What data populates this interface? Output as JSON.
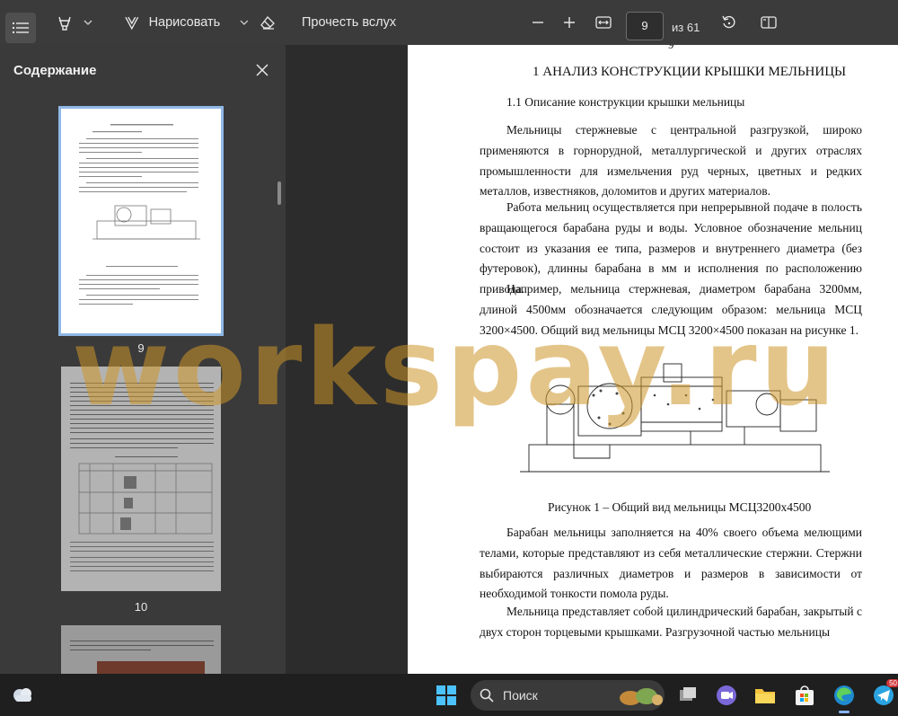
{
  "toolbar": {
    "draw_label": "Нарисовать",
    "read_aloud_label": "Прочесть вслух",
    "page_input_value": "9",
    "page_total_label": "из 61"
  },
  "sidebar": {
    "title": "Содержание",
    "thumbnails": [
      {
        "label": "9"
      },
      {
        "label": "10"
      }
    ]
  },
  "document": {
    "page_number": "9",
    "heading": "1 АНАЛИЗ КОНСТРУКЦИИ КРЫШКИ МЕЛЬНИЦЫ",
    "subheading": "1.1 Описание конструкции крышки мельницы",
    "paragraphs": [
      "Мельницы стержневые с центральной разгрузкой, широко применяются в горнорудной, металлургической и других отраслях промышленности для измельчения руд черных, цветных и редких металлов, известняков, доломитов и других материалов.",
      "Работа мельниц осуществляется при непрерывной подаче в полость вращающегося барабана руды и воды. Условное обозначение мельниц состоит из указания ее типа, размеров и внутреннего диаметра (без футеровок), длинны барабана в мм и исполнения по расположению привода.",
      "Например, мельница стержневая, диаметром барабана 3200мм, длиной 4500мм обозначается следующим образом: мельница МСЦ 3200×4500. Общий вид мельницы МСЦ 3200×4500 показан на рисунке 1.",
      "Барабан мельницы заполняется на 40% своего объема мелющими телами, которые представляют из себя металлические стержни. Стержни выбираются различных диаметров и размеров в зависимости от необходимой тонкости помола руды.",
      "Мельница представляет собой цилиндрический барабан, закрытый с двух сторон торцевыми крышками. Разгрузочной частью мельницы"
    ],
    "figure_caption": "Рисунок 1 – Общий вид мельницы МСЦ3200x4500"
  },
  "watermark": "workspay.ru",
  "taskbar": {
    "search_label": "Поиск",
    "telegram_badge": "50"
  },
  "colors": {
    "toolbar_bg": "#3b3b3b",
    "sidebar_bg": "#3a3a3a",
    "selected_thumb_border": "#8fb8e6",
    "watermark": "#ce9628",
    "taskbar_bg": "#1f1f1f"
  }
}
